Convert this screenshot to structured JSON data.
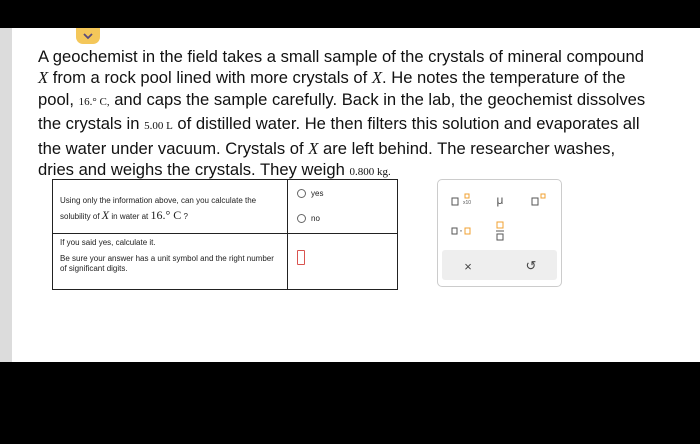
{
  "question": {
    "part1": "A geochemist in the field takes a small sample of the crystals of mineral compound ",
    "var_x": "X",
    "part2": " from a rock pool lined with more crystals of ",
    "part3": ". He notes the temperature of the pool, ",
    "temperature": "16.° C,",
    "part4": " and caps the sample carefully. Back in the lab, the geochemist dissolves the crystals in ",
    "volume": "5.00 L",
    "part5": " of distilled water. He then filters this solution and evaporates all the water under vacuum. Crystals of ",
    "part6": " are left behind. The researcher washes, dries and weighs the crystals. They weigh ",
    "mass": "0.800 kg."
  },
  "table": {
    "q1_part1": "Using only the information above, can you calculate the solubility of ",
    "q1_var": "X",
    "q1_part2": " in water at ",
    "q1_temp": "16.° C",
    "q1_end": " ?",
    "option_yes": "yes",
    "option_no": "no",
    "q2_text": "If you said yes, calculate it.",
    "q2_note": "Be sure your answer has a unit symbol and the right number of significant digits."
  },
  "palette": {
    "x10_label": "x10",
    "mu_label": "μ",
    "dot_label": "·",
    "clear_label": "×",
    "undo_label": "↺"
  },
  "colors": {
    "accent": "#f4c75a",
    "box_orange": "#f0a030",
    "answer_red": "#d9534f"
  }
}
